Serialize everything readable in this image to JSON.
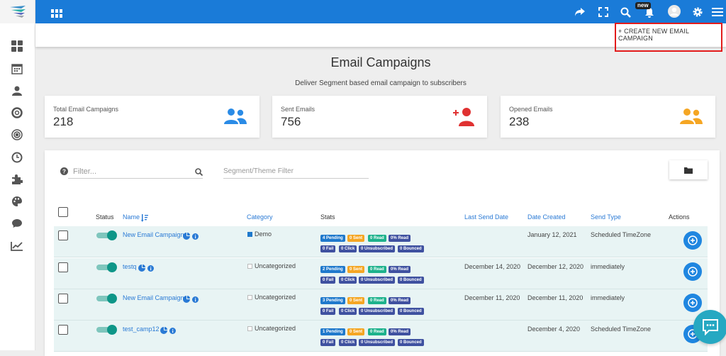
{
  "topbar": {
    "new_badge": "new"
  },
  "toolbar": {
    "create_label": "+ CREATE NEW EMAIL CAMPAIGN"
  },
  "page": {
    "title": "Email Campaigns",
    "subtitle": "Deliver Segment based email campaign to subscribers"
  },
  "cards": [
    {
      "label": "Total Email Campaigns",
      "value": "218",
      "icon": "users-icon",
      "color": "#2a8be6"
    },
    {
      "label": "Sent Emails",
      "value": "756",
      "icon": "add-user-icon",
      "color": "#e03131"
    },
    {
      "label": "Opened Emails",
      "value": "238",
      "icon": "users-icon",
      "color": "#f5a623"
    }
  ],
  "filters": {
    "search_placeholder": "Filter...",
    "segment_placeholder": "Segment/Theme Filter"
  },
  "table": {
    "headers": {
      "status": "Status",
      "name": "Name",
      "category": "Category",
      "stats": "Stats",
      "last_send": "Last Send Date",
      "created": "Date Created",
      "send_type": "Send Type",
      "actions": "Actions"
    },
    "rows": [
      {
        "name": "New Email Campaign",
        "category": "Demo",
        "badges_top": [
          "4 Pending",
          "0 Sent",
          "0 Read",
          "0% Read"
        ],
        "badges_bottom": [
          "0 Fail",
          "0 Click",
          "0 Unsubscribed",
          "0 Bounced"
        ],
        "last_send": "",
        "created": "January 12, 2021",
        "send_type": "Scheduled TimeZone"
      },
      {
        "name": "testq",
        "category": "Uncategorized",
        "badges_top": [
          "2 Pending",
          "0 Sent",
          "0 Read",
          "0% Read"
        ],
        "badges_bottom": [
          "0 Fail",
          "0 Click",
          "0 Unsubscribed",
          "0 Bounced"
        ],
        "last_send": "December 14, 2020",
        "created": "December 12, 2020",
        "send_type": "immediately"
      },
      {
        "name": "New Email Campaign",
        "category": "Uncategorized",
        "badges_top": [
          "3 Pending",
          "0 Sent",
          "0 Read",
          "0% Read"
        ],
        "badges_bottom": [
          "0 Fail",
          "0 Click",
          "0 Unsubscribed",
          "0 Bounced"
        ],
        "last_send": "December 11, 2020",
        "created": "December 11, 2020",
        "send_type": "immediately"
      },
      {
        "name": "test_camp12",
        "category": "Uncategorized",
        "badges_top": [
          "1 Pending",
          "0 Sent",
          "0 Read",
          "0% Read"
        ],
        "badges_bottom": [
          "0 Fail",
          "0 Click",
          "0 Unsubscribed",
          "0 Bounced"
        ],
        "last_send": "",
        "created": "December 4, 2020",
        "send_type": "Scheduled TimeZone"
      }
    ]
  }
}
